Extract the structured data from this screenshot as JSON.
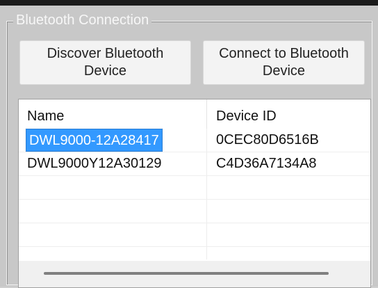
{
  "group": {
    "title": "Bluetooth Connection"
  },
  "buttons": {
    "discover": "Discover Bluetooth\nDevice",
    "connect": "Connect to Bluetooth\nDevice"
  },
  "list": {
    "columns": {
      "name": "Name",
      "device_id": "Device ID"
    },
    "rows": [
      {
        "name": "DWL9000-12A28417",
        "device_id": "0CEC80D6516B",
        "selected": true
      },
      {
        "name": "DWL9000Y12A30129",
        "device_id": "C4D36A7134A8",
        "selected": false
      }
    ]
  },
  "colors": {
    "selection": "#3399ff",
    "panel": "#c8c8c8",
    "button_bg": "#f3f3f3"
  }
}
